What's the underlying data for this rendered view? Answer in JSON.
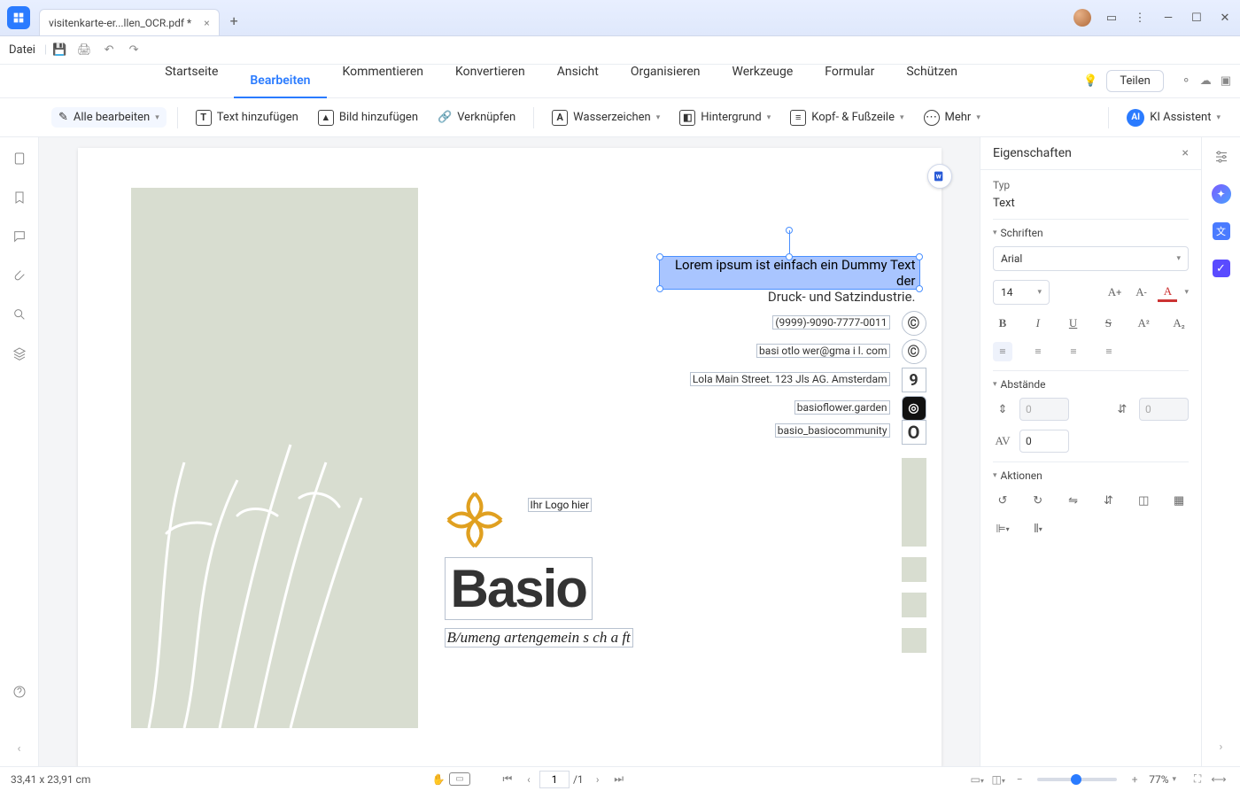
{
  "titlebar": {
    "tab_title": "visitenkarte-er...llen_OCR.pdf *"
  },
  "quickbar": {
    "file": "Datei"
  },
  "menu": {
    "start": "Startseite",
    "edit": "Bearbeiten",
    "comment": "Kommentieren",
    "convert": "Konvertieren",
    "view": "Ansicht",
    "organize": "Organisieren",
    "tools": "Werkzeuge",
    "form": "Formular",
    "protect": "Schützen",
    "share": "Teilen"
  },
  "toolbar": {
    "edit_all": "Alle bearbeiten",
    "add_text": "Text hinzufügen",
    "add_image": "Bild hinzufügen",
    "link": "Verknüpfen",
    "watermark": "Wasserzeichen",
    "background": "Hintergrund",
    "header_footer": "Kopf- & Fußzeile",
    "more": "Mehr",
    "ai": "KI Assistent"
  },
  "document": {
    "selected_line1": "Lorem ipsum ist einfach ein Dummy Text der",
    "selected_line2": "Druck- und Satzindustrie.",
    "phone": "(9999)-9090-7777-0011",
    "email": "basi otlo wer@gma i l. com",
    "address": "Lola Main Street. 123 Jls AG. Amsterdam",
    "website": "basioflower.garden",
    "social": "basio_basiocommunity",
    "logo_label": "Ihr Logo hier",
    "title": "Basio",
    "subtitle": "B/umeng artengemein s ch a ft"
  },
  "panel": {
    "title": "Eigenschaften",
    "type_label": "Typ",
    "type_value": "Text",
    "fonts": "Schriften",
    "font_name": "Arial",
    "font_size": "14",
    "spacing": "Abstände",
    "char_spacing": "0",
    "actions": "Aktionen"
  },
  "status": {
    "dimensions": "33,41 x 23,91 cm",
    "page_current": "1",
    "page_total": "/1",
    "zoom": "77%"
  }
}
